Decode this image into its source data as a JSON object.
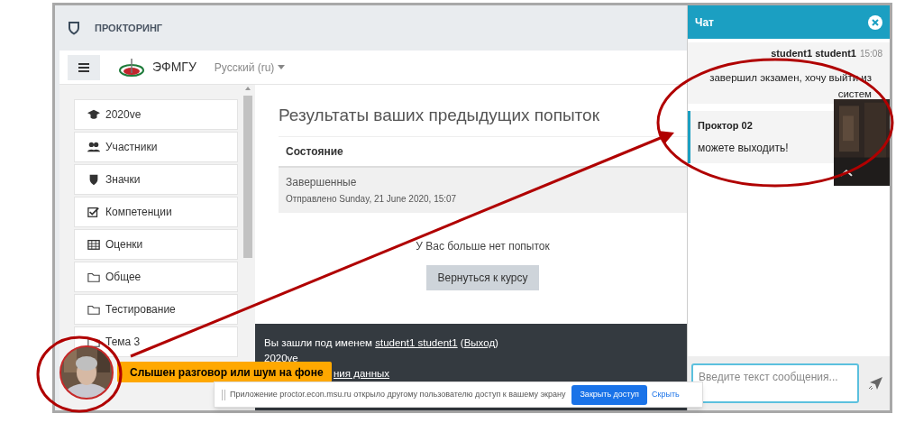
{
  "header": {
    "title": "ПРОКТОРИНГ"
  },
  "navbar": {
    "site_name": "ЭФМГУ",
    "language": "Русский (ru)"
  },
  "sidebar": {
    "items": [
      {
        "kind": "course",
        "label": "2020ve"
      },
      {
        "kind": "participants",
        "label": "Участники"
      },
      {
        "kind": "badges",
        "label": "Значки"
      },
      {
        "kind": "competencies",
        "label": "Компетенции"
      },
      {
        "kind": "grades",
        "label": "Оценки"
      },
      {
        "kind": "folder",
        "label": "Общее"
      },
      {
        "kind": "folder",
        "label": "Тестирование"
      },
      {
        "kind": "folder",
        "label": "Тема 3"
      }
    ]
  },
  "main": {
    "title": "Результаты ваших предыдущих попыток",
    "table": {
      "columns": [
        "Состояние"
      ],
      "rows": [
        {
          "status": "Завершенные",
          "submitted": "Отправлено Sunday, 21 June 2020, 15:07"
        }
      ]
    },
    "no_attempts": "У Вас больше нет попыток",
    "back_button": "Вернуться к курсу"
  },
  "footer": {
    "lines": [
      [
        {
          "kind": "text",
          "text": "Вы зашли под именем "
        },
        {
          "kind": "link",
          "text": "student1 student1"
        },
        {
          "kind": "text",
          "text": " ("
        },
        {
          "kind": "link",
          "text": "Выход"
        },
        {
          "kind": "text",
          "text": ")"
        }
      ],
      [
        {
          "kind": "link",
          "text": "2020ve"
        }
      ],
      [
        {
          "kind": "link",
          "text": "ния данных"
        }
      ]
    ]
  },
  "chat": {
    "title": "Чат",
    "messages": [
      {
        "kind": "own",
        "author": "student1 student1",
        "time": "15:08",
        "text": "завершил экзамен, хочу выйти из систем"
      },
      {
        "kind": "other",
        "author": "Проктор 02",
        "text": "можете выходить!"
      }
    ],
    "input": {
      "placeholder": "Введите текст сообщения..."
    }
  },
  "notification": {
    "text": "Слышен разговор или шум на фоне"
  },
  "share_bar": {
    "message": "Приложение proctor.econ.msu.ru открыло другому пользователю доступ к вашему экрану",
    "stop_button": "Закрыть доступ",
    "hide_link": "Скрыть"
  }
}
